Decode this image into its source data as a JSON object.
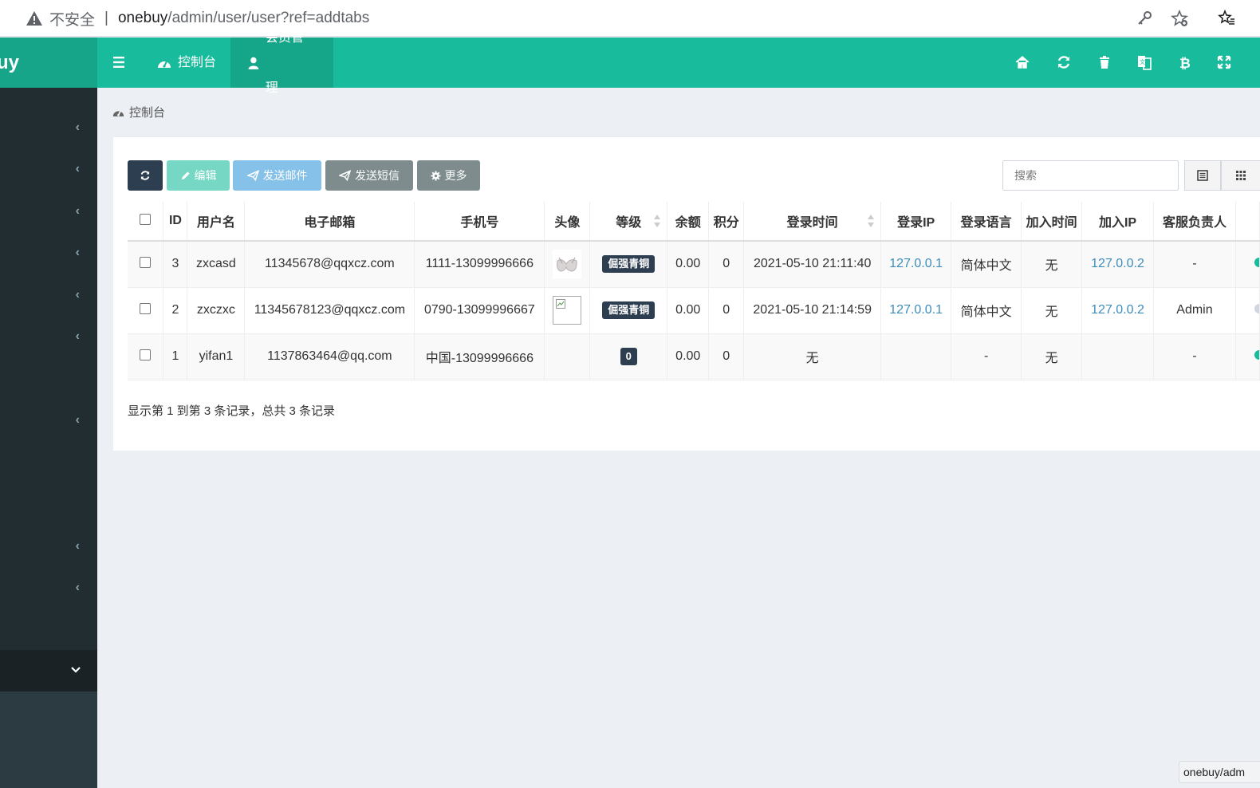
{
  "browser": {
    "insecure_label": "不安全",
    "separator": "|",
    "url_host": "onebuy",
    "url_path": "/admin/user/user?ref=addtabs"
  },
  "sidebar": {
    "logo_text": "uy"
  },
  "topnav": {
    "tabs": [
      {
        "label": "控制台",
        "icon": "dashboard-icon"
      },
      {
        "label": "会员管理",
        "icon": "user-icon"
      }
    ],
    "right_icons": [
      "home-icon",
      "refresh-icon",
      "trash-icon",
      "translate-icon",
      "bitcoin-icon",
      "fullscreen-icon"
    ]
  },
  "breadcrumb": {
    "label": "控制台"
  },
  "toolbar": {
    "edit_label": "编辑",
    "email_label": "发送邮件",
    "sms_label": "发送短信",
    "more_label": "更多",
    "search_placeholder": "搜索"
  },
  "table": {
    "headers": [
      "ID",
      "用户名",
      "电子邮箱",
      "手机号",
      "头像",
      "等级",
      "余额",
      "积分",
      "登录时间",
      "登录IP",
      "登录语言",
      "加入时间",
      "加入IP",
      "客服负责人"
    ],
    "rows": [
      {
        "id": "3",
        "username": "zxcasd",
        "email": "11345678@qqxcz.com",
        "mobile": "1111-13099996666",
        "level": "倔强青铜",
        "money": "0.00",
        "score": "0",
        "logintime": "2021-05-10 21:11:40",
        "loginip": "127.0.0.1",
        "lang": "简体中文",
        "jointime": "无",
        "joinip": "127.0.0.2",
        "service": "-"
      },
      {
        "id": "2",
        "username": "zxczxc",
        "email": "11345678123@qqxcz.com",
        "mobile": "0790-13099996667",
        "level": "倔强青铜",
        "money": "0.00",
        "score": "0",
        "logintime": "2021-05-10 21:14:59",
        "loginip": "127.0.0.1",
        "lang": "简体中文",
        "jointime": "无",
        "joinip": "127.0.0.2",
        "service": "Admin"
      },
      {
        "id": "1",
        "username": "yifan1",
        "email": "1137863464@qq.com",
        "mobile": "中国-13099996666",
        "level": "0",
        "money": "0.00",
        "score": "0",
        "logintime": "无",
        "loginip": "",
        "lang": "-",
        "jointime": "无",
        "joinip": "",
        "service": "-"
      }
    ]
  },
  "pager": {
    "info": "显示第 1 到第 3 条记录，总共 3 条记录"
  },
  "status_tip": "onebuy/adm",
  "colors": {
    "accent": "#18bc9c",
    "sidebar": "#222d32",
    "badge": "#2c3e50",
    "link": "#3c8dbc"
  }
}
